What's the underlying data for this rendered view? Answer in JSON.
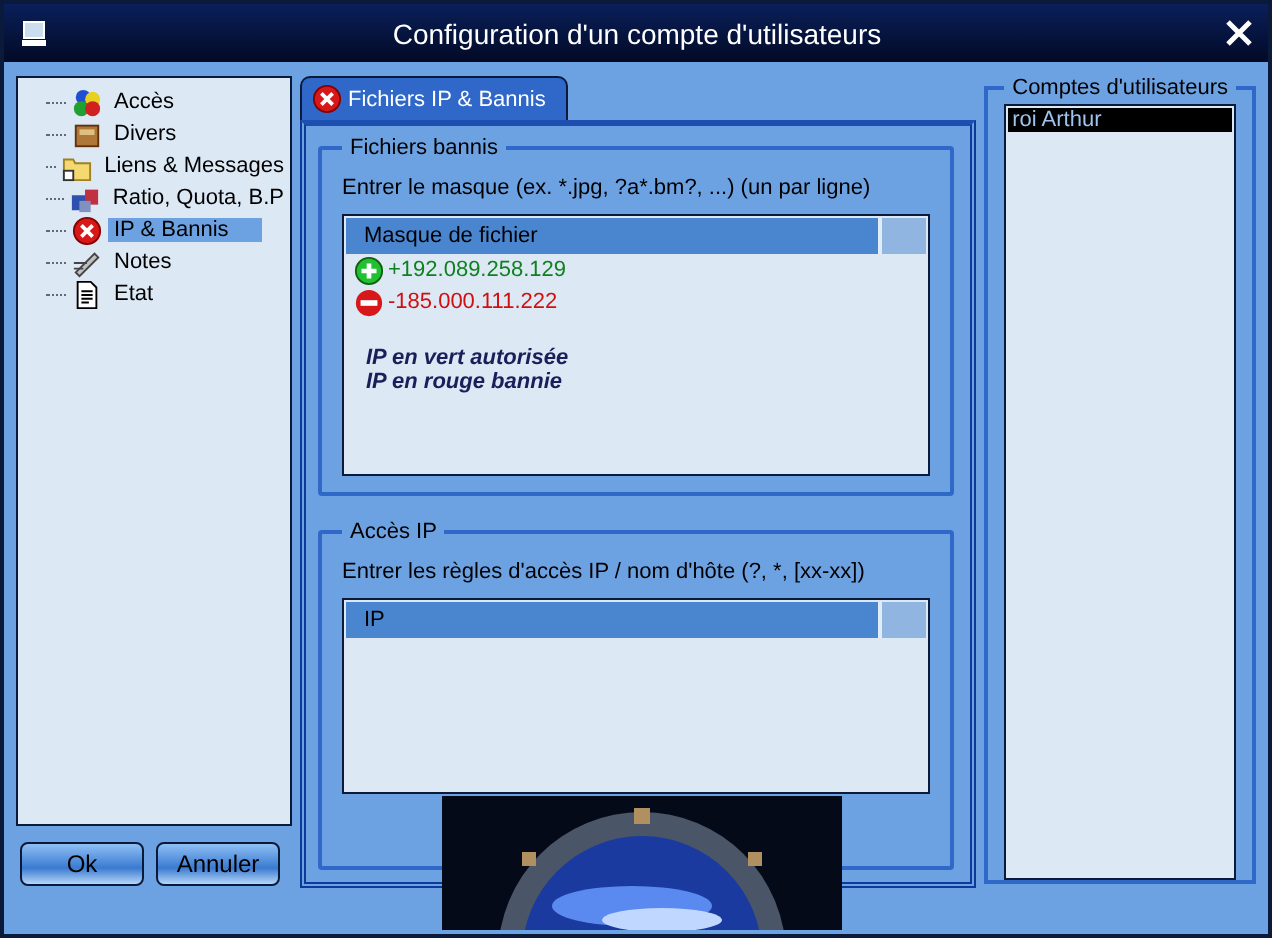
{
  "window": {
    "title": "Configuration d'un compte d'utilisateurs"
  },
  "sidebar": {
    "items": [
      {
        "label": "Accès",
        "selected": false
      },
      {
        "label": "Divers",
        "selected": false
      },
      {
        "label": "Liens & Messages",
        "selected": false
      },
      {
        "label": "Ratio, Quota, B.P",
        "selected": false
      },
      {
        "label": "IP & Bannis",
        "selected": true
      },
      {
        "label": "Notes",
        "selected": false
      },
      {
        "label": "Etat",
        "selected": false
      }
    ]
  },
  "buttons": [
    "Ok",
    "Annuler"
  ],
  "tab": {
    "label": "Fichiers IP & Bannis",
    "selected": true
  },
  "banned_files": {
    "title": "Fichiers bannis",
    "instruction": "Entrer le masque (ex. *.jpg, ?a*.bm?, ...) (un par ligne)",
    "column": "Masque de fichier",
    "rows": [
      {
        "kind": "allow",
        "text": "+192.089.258.129"
      },
      {
        "kind": "deny",
        "text": "-185.000.111.222"
      }
    ],
    "notes": [
      "IP en vert autorisée",
      "IP en rouge bannie"
    ]
  },
  "ip_access": {
    "title": "Accès IP",
    "instruction": "Entrer les règles d'accès IP / nom d'hôte (?, *, [xx-xx])",
    "column": "IP"
  },
  "accounts": {
    "title": "Comptes d'utilisateurs",
    "items": [
      {
        "label": "roi Arthur",
        "selected": true
      }
    ]
  }
}
